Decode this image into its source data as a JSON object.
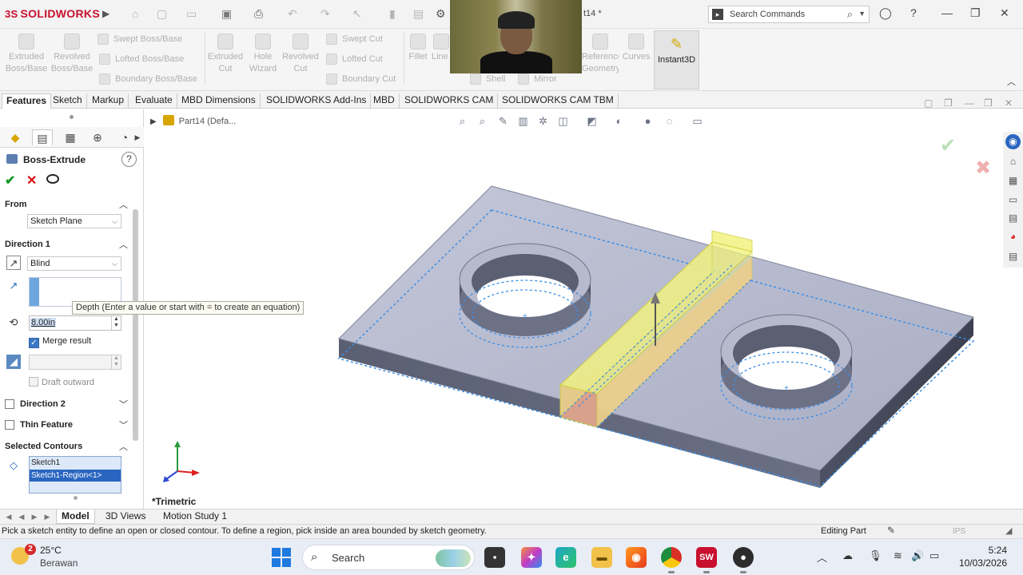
{
  "app": {
    "brand": "SOLIDWORKS",
    "brand_prefix": "3S",
    "doc_title": "t14 *"
  },
  "search": {
    "placeholder": "Search Commands"
  },
  "ribbon": {
    "extruded_boss": "Extruded Boss/Base",
    "revolved_boss": "Revolved Boss/Base",
    "swept_boss": "Swept Boss/Base",
    "lofted_boss": "Lofted Boss/Base",
    "boundary_boss": "Boundary Boss/Base",
    "extruded_cut": "Extruded Cut",
    "hole_wizard": "Hole Wizard",
    "revolved_cut": "Revolved Cut",
    "swept_cut": "Swept Cut",
    "lofted_cut": "Lofted Cut",
    "boundary_cut": "Boundary Cut",
    "fillet": "Fillet",
    "linear_pattern": "Line Patt",
    "shell": "Shell",
    "mirror": "Mirror",
    "reference_geometry": "Reference Geometry",
    "curves": "Curves",
    "instant3d": "Instant3D"
  },
  "tabs": [
    "Features",
    "Sketch",
    "Markup",
    "Evaluate",
    "MBD Dimensions",
    "SOLIDWORKS Add-Ins",
    "MBD",
    "SOLIDWORKS CAM",
    "SOLIDWORKS CAM TBM"
  ],
  "property_manager": {
    "title": "Boss-Extrude",
    "from": {
      "label": "From",
      "value": "Sketch Plane"
    },
    "direction1": {
      "label": "Direction 1",
      "end_condition": "Blind",
      "depth": "8.00in",
      "merge_result": "Merge result",
      "draft_outward": "Draft outward"
    },
    "direction2": {
      "label": "Direction 2"
    },
    "thin_feature": {
      "label": "Thin Feature"
    },
    "selected_contours": {
      "label": "Selected Contours",
      "items": [
        "Sketch1",
        "Sketch1-Region<1>"
      ]
    }
  },
  "tooltip": "Depth (Enter a value or start with = to create an equation)",
  "viewport": {
    "tree_path": "Part14  (Defa...",
    "view_name": "*Trimetric"
  },
  "bottom_tabs": [
    "Model",
    "3D Views",
    "Motion Study 1"
  ],
  "status": {
    "message": "Pick a sketch entity to define an open or closed contour. To define a region, pick inside an area bounded by sketch geometry.",
    "mode": "Editing Part",
    "units": "IPS"
  },
  "taskbar": {
    "weather_badge": "2",
    "temperature": "25°C",
    "condition": "Berawan",
    "search_placeholder": "Search",
    "time": "5:24",
    "date": "10/03/2026"
  },
  "colors": {
    "brand_red": "#c8102e",
    "ok_green": "#1a9a2a",
    "cancel_red": "#dd1111",
    "selection_blue": "#2a66c1",
    "feature_preview_yellow": "#f2f27a",
    "sketch_dash_blue": "#3a8ee6"
  }
}
